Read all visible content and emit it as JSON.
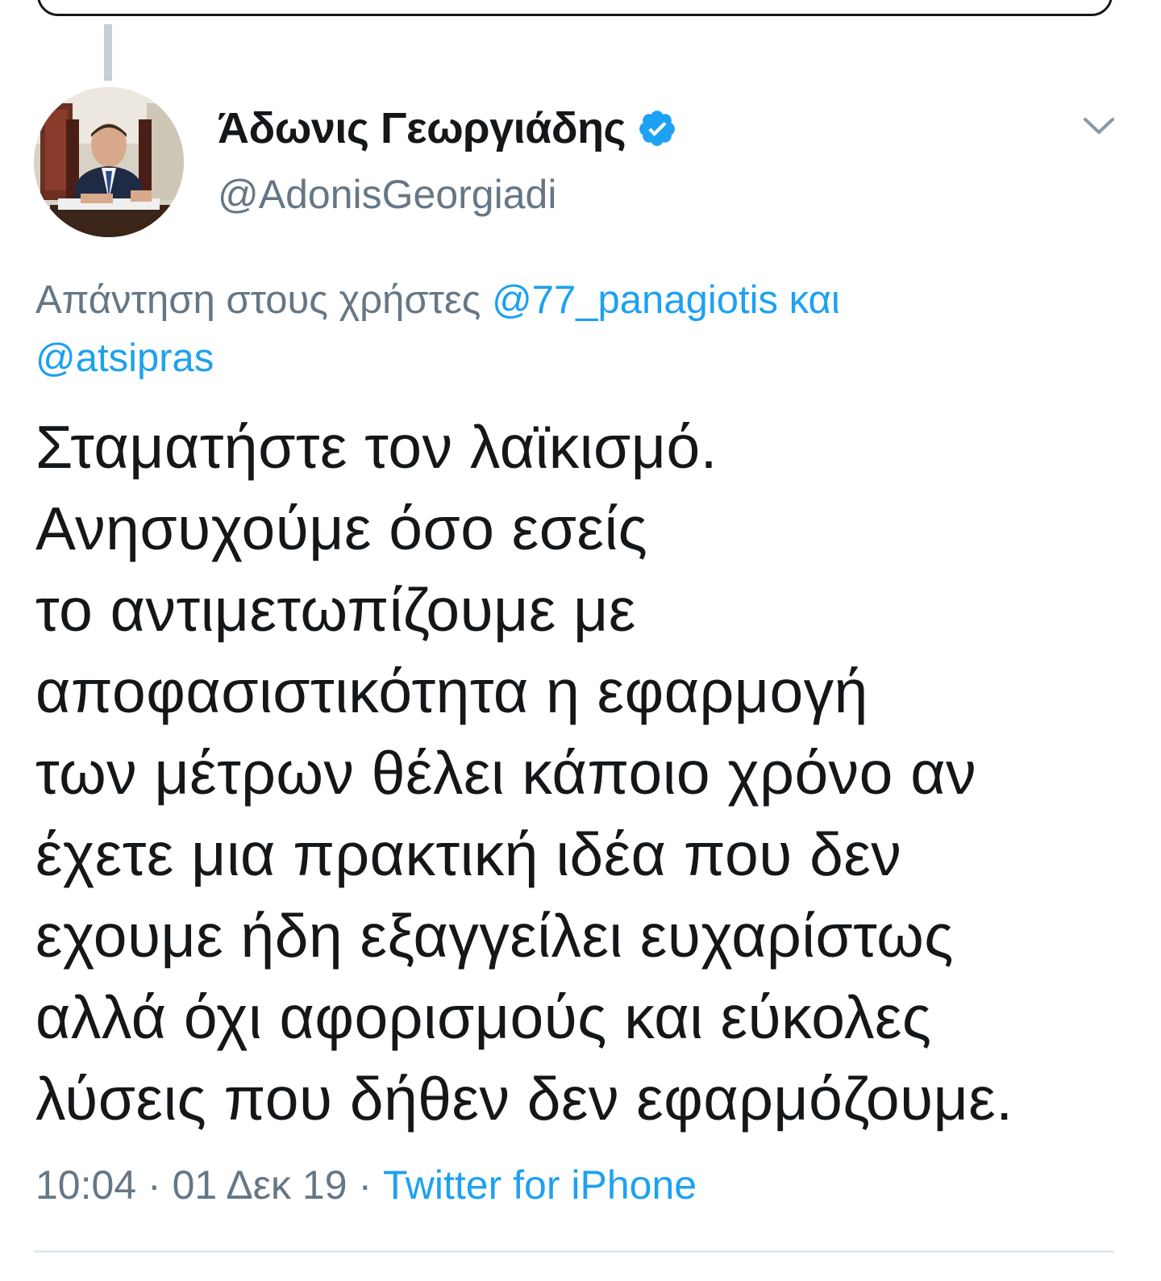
{
  "author": {
    "display_name": "Άδωνις Γεωργιάδης",
    "handle": "@AdonisGeorgiadi",
    "verified": true,
    "avatar_icon": "profile-photo"
  },
  "reply": {
    "prefix": "Απάντηση στους χρήστες",
    "mention_1": "@77_panagiotis",
    "connector": "και",
    "mention_2": "@atsipras"
  },
  "tweet": {
    "lines": [
      "Σταματήστε τον λαϊκισμό.",
      "Ανησυχούμε όσο εσείς",
      "το αντιμετωπίζουμε με",
      "αποφασιστικότητα η εφαρμογή",
      "των μέτρων θέλει κάποιο χρόνο αν",
      "έχετε μια πρακτική ιδέα που δεν",
      "εχουμε ήδη εξαγγείλει ευχαρίστως",
      "αλλά όχι αφορισμούς και εύκολες",
      "λύσεις που δήθεν δεν εφαρμόζουμε."
    ]
  },
  "meta": {
    "time": "10:04",
    "date": "01 Δεκ 19",
    "separator": "·",
    "source": "Twitter for iPhone"
  },
  "icons": {
    "verified": "verified-badge-icon",
    "more": "chevron-down-icon"
  },
  "colors": {
    "link": "#1da1f2",
    "secondary_text": "#657786",
    "primary_text": "#14171a",
    "thread_line": "#c4cfd6",
    "divider": "#e1e8ed"
  }
}
